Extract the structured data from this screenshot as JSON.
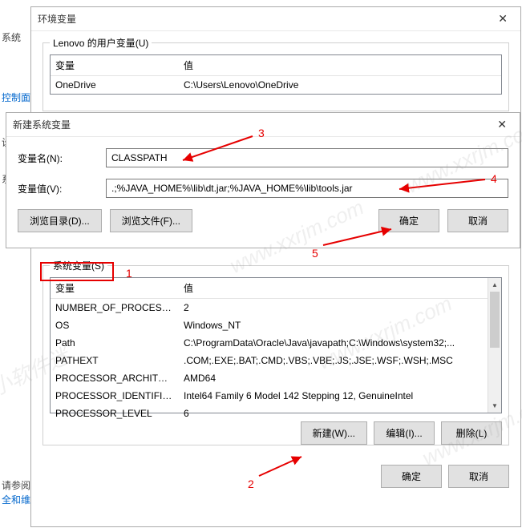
{
  "sidebar": {
    "system": "系统",
    "control_panel": "控制面板",
    "settings": "设",
    "system2": "系",
    "ref": "请参阅",
    "security": "全和维"
  },
  "env_window": {
    "title": "环境变量",
    "user_vars_label": "Lenovo 的用户变量(U)",
    "col_var": "变量",
    "col_val": "值",
    "user_rows": [
      {
        "var": "OneDrive",
        "val": "C:\\Users\\Lenovo\\OneDrive"
      }
    ],
    "sys_vars_label": "系统变量(S)",
    "sys_rows": [
      {
        "var": "NUMBER_OF_PROCESSORS",
        "val": "2"
      },
      {
        "var": "OS",
        "val": "Windows_NT"
      },
      {
        "var": "Path",
        "val": "C:\\ProgramData\\Oracle\\Java\\javapath;C:\\Windows\\system32;..."
      },
      {
        "var": "PATHEXT",
        "val": ".COM;.EXE;.BAT;.CMD;.VBS;.VBE;.JS;.JSE;.WSF;.WSH;.MSC"
      },
      {
        "var": "PROCESSOR_ARCHITECT...",
        "val": "AMD64"
      },
      {
        "var": "PROCESSOR_IDENTIFIER",
        "val": "Intel64 Family 6 Model 142 Stepping 12, GenuineIntel"
      },
      {
        "var": "PROCESSOR_LEVEL",
        "val": "6"
      }
    ],
    "btn_new": "新建(W)...",
    "btn_edit": "编辑(I)...",
    "btn_delete": "删除(L)",
    "btn_ok": "确定",
    "btn_cancel": "取消"
  },
  "new_var_window": {
    "title": "新建系统变量",
    "name_label": "变量名(N):",
    "name_value": "CLASSPATH",
    "value_label": "变量值(V):",
    "value_value": ".;%JAVA_HOME%\\lib\\dt.jar;%JAVA_HOME%\\lib\\tools.jar",
    "btn_browse_dir": "浏览目录(D)...",
    "btn_browse_file": "浏览文件(F)...",
    "btn_ok": "确定",
    "btn_cancel": "取消"
  },
  "annotations": {
    "n1": "1",
    "n2": "2",
    "n3": "3",
    "n4": "4",
    "n5": "5"
  },
  "watermarks": [
    "小小软件迷",
    "www.xxrjm.com",
    "www.xxrjm.com",
    "www.xxrjm.com",
    "www.xxrjm.com"
  ]
}
